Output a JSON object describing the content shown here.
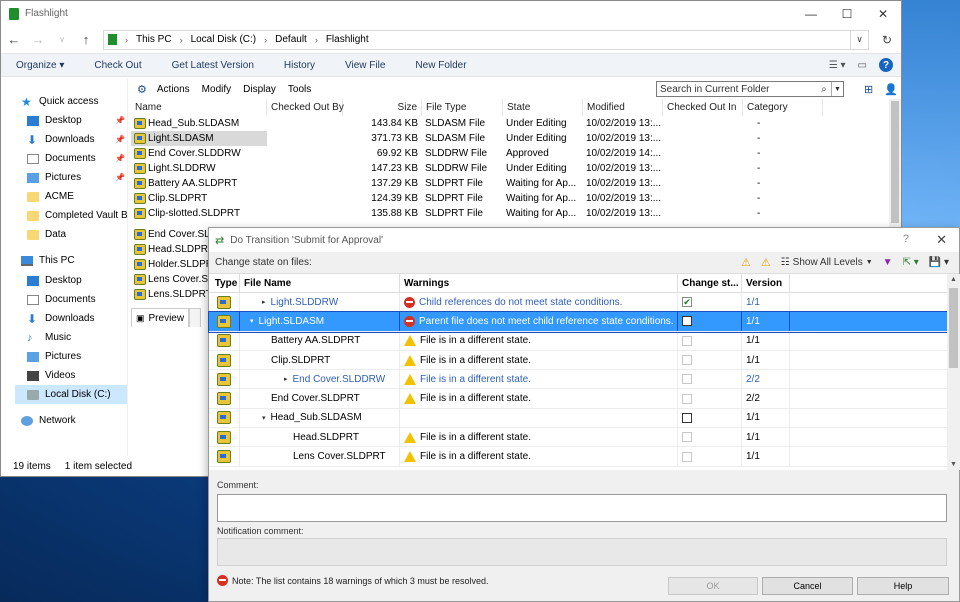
{
  "window": {
    "title": "Flashlight"
  },
  "address": {
    "parts": [
      "This PC",
      "Local Disk (C:)",
      "Default",
      "Flashlight"
    ]
  },
  "commandbar": {
    "organize": "Organize ▾",
    "check_out": "Check Out",
    "get_latest": "Get Latest Version",
    "history": "History",
    "view_file": "View File",
    "new_folder": "New Folder"
  },
  "nav": {
    "quick_access": "Quick access",
    "desktop": "Desktop",
    "downloads": "Downloads",
    "documents": "Documents",
    "pictures": "Pictures",
    "acme": "ACME",
    "completed": "Completed Vault Ba",
    "data": "Data",
    "this_pc": "This PC",
    "pc_desktop": "Desktop",
    "pc_documents": "Documents",
    "pc_downloads": "Downloads",
    "pc_music": "Music",
    "pc_pictures": "Pictures",
    "pc_videos": "Videos",
    "pc_localdisk": "Local Disk (C:)",
    "network": "Network"
  },
  "status": {
    "items": "19 items",
    "selected": "1 item selected"
  },
  "vault_toolbar": {
    "actions": "Actions",
    "modify": "Modify",
    "display": "Display",
    "tools": "Tools",
    "search_placeholder": "Search in Current Folder"
  },
  "filelist": {
    "headers": {
      "name": "Name",
      "checked_out_by": "Checked Out By",
      "size": "Size",
      "file_type": "File Type",
      "state": "State",
      "modified": "Modified",
      "checked_out_in": "Checked Out In",
      "category": "Category"
    },
    "rows": [
      {
        "name": "Head_Sub.SLDASM",
        "size": "143.84 KB",
        "type": "SLDASM File",
        "state": "Under Editing",
        "modified": "10/02/2019 13:...",
        "category": "-"
      },
      {
        "name": "Light.SLDASM",
        "size": "371.73 KB",
        "type": "SLDASM File",
        "state": "Under Editing",
        "modified": "10/02/2019 13:...",
        "category": "-"
      },
      {
        "name": "End Cover.SLDDRW",
        "size": "69.92 KB",
        "type": "SLDDRW File",
        "state": "Approved",
        "modified": "10/02/2019 14:...",
        "category": "-"
      },
      {
        "name": "Light.SLDDRW",
        "size": "147.23 KB",
        "type": "SLDDRW File",
        "state": "Under Editing",
        "modified": "10/02/2019 13:...",
        "category": "-"
      },
      {
        "name": "Battery AA.SLDPRT",
        "size": "137.29 KB",
        "type": "SLDPRT File",
        "state": "Waiting for Ap...",
        "modified": "10/02/2019 13:...",
        "category": "-"
      },
      {
        "name": "Clip.SLDPRT",
        "size": "124.39 KB",
        "type": "SLDPRT File",
        "state": "Waiting for Ap...",
        "modified": "10/02/2019 13:...",
        "category": "-"
      },
      {
        "name": "Clip-slotted.SLDPRT",
        "size": "135.88 KB",
        "type": "SLDPRT File",
        "state": "Waiting for Ap...",
        "modified": "10/02/2019 13:...",
        "category": "-"
      }
    ],
    "partial": [
      "End Cover.SLD",
      "Head.SLDPRT",
      "Holder.SLDPRT",
      "Lens Cover.SL",
      "Lens.SLDPRT"
    ]
  },
  "preview_tab": "Preview",
  "dialog": {
    "title": "Do Transition 'Submit for Approval'",
    "help_q": "?",
    "toolbar_label": "Change state on files:",
    "show_all_levels": "Show All Levels",
    "headers": {
      "type": "Type",
      "file_name": "File Name",
      "warnings": "Warnings",
      "change_state": "Change st...",
      "version": "Version"
    },
    "rows": [
      {
        "name": "Light.SLDDRW",
        "indent": 1,
        "twisty": "▸",
        "link": true,
        "warn_kind": "error",
        "warning": "Child references do not meet state conditions.",
        "check": "checked",
        "version": "1/1",
        "ver_link": true
      },
      {
        "name": "Light.SLDASM",
        "indent": 0,
        "twisty": "▾",
        "link": false,
        "warn_kind": "error",
        "warning": "Parent file does not meet child reference state conditions.",
        "check": "empty-dark",
        "version": "1/1",
        "ver_link": false,
        "selected": true
      },
      {
        "name": "Battery AA.SLDPRT",
        "indent": 1,
        "twisty": "",
        "link": false,
        "warn_kind": "warn",
        "warning": "File is in a different state.",
        "check": "dim",
        "version": "1/1",
        "ver_link": false
      },
      {
        "name": "Clip.SLDPRT",
        "indent": 1,
        "twisty": "",
        "link": false,
        "warn_kind": "warn",
        "warning": "File is in a different state.",
        "check": "dim",
        "version": "1/1",
        "ver_link": false
      },
      {
        "name": "End Cover.SLDDRW",
        "indent": 2,
        "twisty": "▸",
        "link": true,
        "warn_kind": "warn",
        "warning": "File is in a different state.",
        "check": "dim",
        "version": "2/2",
        "ver_link": true
      },
      {
        "name": "End Cover.SLDPRT",
        "indent": 1,
        "twisty": "",
        "link": false,
        "warn_kind": "warn",
        "warning": "File is in a different state.",
        "check": "dim",
        "version": "2/2",
        "ver_link": false
      },
      {
        "name": "Head_Sub.SLDASM",
        "indent": 1,
        "twisty": "▾",
        "link": false,
        "warn_kind": "none",
        "warning": "",
        "check": "empty-dark",
        "version": "1/1",
        "ver_link": false
      },
      {
        "name": "Head.SLDPRT",
        "indent": 2,
        "twisty": "",
        "link": false,
        "warn_kind": "warn",
        "warning": "File is in a different state.",
        "check": "dim",
        "version": "1/1",
        "ver_link": false
      },
      {
        "name": "Lens Cover.SLDPRT",
        "indent": 2,
        "twisty": "",
        "link": false,
        "warn_kind": "warn",
        "warning": "File is in a different state.",
        "check": "dim",
        "version": "1/1",
        "ver_link": false
      }
    ],
    "comment_label": "Comment:",
    "notification_label": "Notification comment:",
    "note": "Note: The list contains 18 warnings of which 3 must be resolved.",
    "ok": "OK",
    "cancel": "Cancel",
    "help": "Help"
  }
}
